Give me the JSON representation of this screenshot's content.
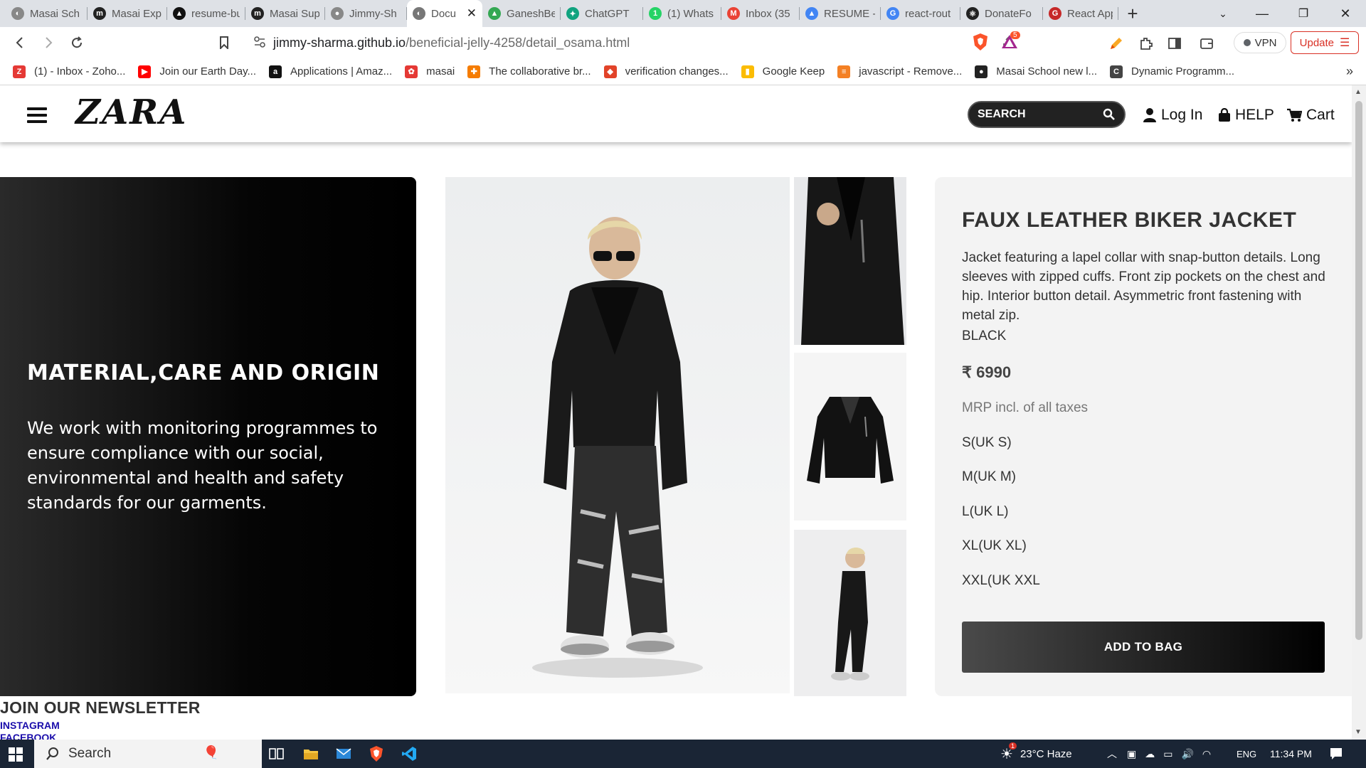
{
  "browser": {
    "tabs": [
      {
        "label": "Masai Sch",
        "color": "#888",
        "glyph": "◐"
      },
      {
        "label": "Masai Exp",
        "color": "#222",
        "glyph": "m"
      },
      {
        "label": "resume-bu",
        "color": "#111",
        "glyph": "▲"
      },
      {
        "label": "Masai Sup",
        "color": "#222",
        "glyph": "m"
      },
      {
        "label": "Jimmy-Sh",
        "color": "#888",
        "glyph": "●"
      },
      {
        "label": "Docu",
        "color": "#777",
        "glyph": "◐",
        "active": true
      },
      {
        "label": "GaneshBe",
        "color": "#34a853",
        "glyph": "▲"
      },
      {
        "label": "ChatGPT",
        "color": "#10a37f",
        "glyph": "✦"
      },
      {
        "label": "(1) Whats",
        "color": "#25d366",
        "glyph": "1"
      },
      {
        "label": "Inbox (35",
        "color": "#ea4335",
        "glyph": "M"
      },
      {
        "label": "RESUME -",
        "color": "#4285f4",
        "glyph": "▲"
      },
      {
        "label": "react-rout",
        "color": "#4285f4",
        "glyph": "G"
      },
      {
        "label": "DonateFo",
        "color": "#222",
        "glyph": "⚛"
      },
      {
        "label": "React App",
        "color": "#c62828",
        "glyph": "G"
      }
    ],
    "new_tab": "+",
    "url_host": "jimmy-sharma.github.io",
    "url_path": "/beneficial-jelly-4258/detail_osama.html",
    "vpn_label": "VPN",
    "update_label": "Update",
    "brave_badge": "5",
    "bookmarks": [
      {
        "label": "(1) - Inbox - Zoho...",
        "color": "#e53935",
        "glyph": "Z"
      },
      {
        "label": "Join our Earth Day...",
        "color": "#ff0000",
        "glyph": "▶"
      },
      {
        "label": "Applications | Amaz...",
        "color": "#111",
        "glyph": "a"
      },
      {
        "label": "masai",
        "color": "#e53935",
        "glyph": "✿"
      },
      {
        "label": "The collaborative br...",
        "color": "#f57c00",
        "glyph": "✚"
      },
      {
        "label": "verification changes...",
        "color": "#e24329",
        "glyph": "◆"
      },
      {
        "label": "Google Keep",
        "color": "#fbbc04",
        "glyph": "▮"
      },
      {
        "label": "javascript - Remove...",
        "color": "#f48024",
        "glyph": "≡"
      },
      {
        "label": "Masai School new l...",
        "color": "#222",
        "glyph": "●"
      },
      {
        "label": "Dynamic Programm...",
        "color": "#444",
        "glyph": "C"
      }
    ],
    "bookmarks_more": "»"
  },
  "site": {
    "logo": "ZARA",
    "search_placeholder": "SEARCH",
    "login_label": "Log In",
    "help_label": "HELP",
    "cart_label": "Cart"
  },
  "material": {
    "heading": "MATERIAL,CARE AND ORIGIN",
    "text": "We work with monitoring programmes to ensure compliance with our social, environmental and health and safety standards for our garments."
  },
  "product": {
    "title": "FAUX LEATHER BIKER JACKET",
    "description": "Jacket featuring a lapel collar with snap-button details. Long sleeves with zipped cuffs. Front zip pockets on the chest and hip. Interior button detail. Asymmetric front fastening with metal zip.",
    "color": "BLACK",
    "price": "₹ 6990",
    "mrp_note": "MRP incl. of all taxes",
    "sizes": [
      "S(UK S)",
      "M(UK M)",
      "L(UK L)",
      "XL(UK XL)",
      "XXL(UK XXL"
    ],
    "add_to_bag": "ADD TO BAG"
  },
  "footer": {
    "newsletter": "JOIN OUR NEWSLETTER",
    "instagram": "INSTAGRAM",
    "facebook": "FACEBOOK"
  },
  "taskbar": {
    "search_label": "Search",
    "weather": "23°C Haze",
    "lang": "ENG",
    "time": "11:34 PM",
    "weather_badge": "1"
  }
}
